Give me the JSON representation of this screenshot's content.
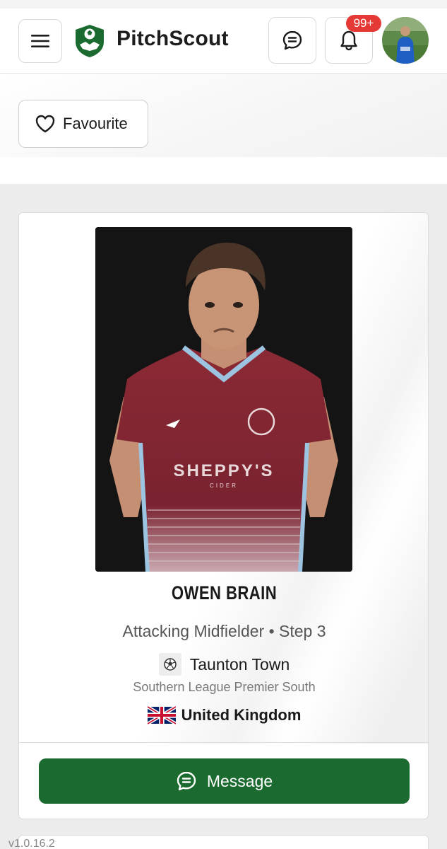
{
  "header": {
    "brand": "PitchScout",
    "notification_count": "99+"
  },
  "actions": {
    "favourite_label": "Favourite",
    "message_label": "Message"
  },
  "player": {
    "name": "OWEN BRAIN",
    "position_line": "Attacking Midfielder • Step 3",
    "club": "Taunton Town",
    "league": "Southern League Premier South",
    "country": "United Kingdom"
  },
  "footer": {
    "version": "v1.0.16.2"
  },
  "icons": {
    "menu": "hamburger-menu-icon",
    "messages": "chat-bubble-icon",
    "notifications": "bell-icon",
    "favourite": "heart-outline-icon",
    "club": "football-icon",
    "country": "uk-flag-icon",
    "message_button": "chat-bubble-icon"
  },
  "colors": {
    "brand_green": "#1b6b30",
    "badge_red": "#e53935"
  }
}
